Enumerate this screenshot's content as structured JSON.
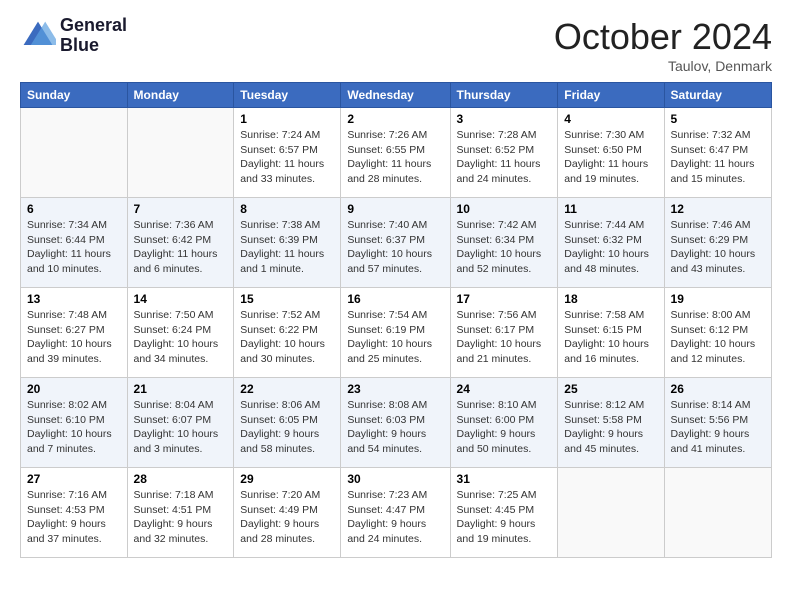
{
  "logo": {
    "line1": "General",
    "line2": "Blue"
  },
  "title": "October 2024",
  "location": "Taulov, Denmark",
  "days_header": [
    "Sunday",
    "Monday",
    "Tuesday",
    "Wednesday",
    "Thursday",
    "Friday",
    "Saturday"
  ],
  "weeks": [
    [
      {
        "day": "",
        "sunrise": "",
        "sunset": "",
        "daylight": ""
      },
      {
        "day": "",
        "sunrise": "",
        "sunset": "",
        "daylight": ""
      },
      {
        "day": "1",
        "sunrise": "Sunrise: 7:24 AM",
        "sunset": "Sunset: 6:57 PM",
        "daylight": "Daylight: 11 hours and 33 minutes."
      },
      {
        "day": "2",
        "sunrise": "Sunrise: 7:26 AM",
        "sunset": "Sunset: 6:55 PM",
        "daylight": "Daylight: 11 hours and 28 minutes."
      },
      {
        "day": "3",
        "sunrise": "Sunrise: 7:28 AM",
        "sunset": "Sunset: 6:52 PM",
        "daylight": "Daylight: 11 hours and 24 minutes."
      },
      {
        "day": "4",
        "sunrise": "Sunrise: 7:30 AM",
        "sunset": "Sunset: 6:50 PM",
        "daylight": "Daylight: 11 hours and 19 minutes."
      },
      {
        "day": "5",
        "sunrise": "Sunrise: 7:32 AM",
        "sunset": "Sunset: 6:47 PM",
        "daylight": "Daylight: 11 hours and 15 minutes."
      }
    ],
    [
      {
        "day": "6",
        "sunrise": "Sunrise: 7:34 AM",
        "sunset": "Sunset: 6:44 PM",
        "daylight": "Daylight: 11 hours and 10 minutes."
      },
      {
        "day": "7",
        "sunrise": "Sunrise: 7:36 AM",
        "sunset": "Sunset: 6:42 PM",
        "daylight": "Daylight: 11 hours and 6 minutes."
      },
      {
        "day": "8",
        "sunrise": "Sunrise: 7:38 AM",
        "sunset": "Sunset: 6:39 PM",
        "daylight": "Daylight: 11 hours and 1 minute."
      },
      {
        "day": "9",
        "sunrise": "Sunrise: 7:40 AM",
        "sunset": "Sunset: 6:37 PM",
        "daylight": "Daylight: 10 hours and 57 minutes."
      },
      {
        "day": "10",
        "sunrise": "Sunrise: 7:42 AM",
        "sunset": "Sunset: 6:34 PM",
        "daylight": "Daylight: 10 hours and 52 minutes."
      },
      {
        "day": "11",
        "sunrise": "Sunrise: 7:44 AM",
        "sunset": "Sunset: 6:32 PM",
        "daylight": "Daylight: 10 hours and 48 minutes."
      },
      {
        "day": "12",
        "sunrise": "Sunrise: 7:46 AM",
        "sunset": "Sunset: 6:29 PM",
        "daylight": "Daylight: 10 hours and 43 minutes."
      }
    ],
    [
      {
        "day": "13",
        "sunrise": "Sunrise: 7:48 AM",
        "sunset": "Sunset: 6:27 PM",
        "daylight": "Daylight: 10 hours and 39 minutes."
      },
      {
        "day": "14",
        "sunrise": "Sunrise: 7:50 AM",
        "sunset": "Sunset: 6:24 PM",
        "daylight": "Daylight: 10 hours and 34 minutes."
      },
      {
        "day": "15",
        "sunrise": "Sunrise: 7:52 AM",
        "sunset": "Sunset: 6:22 PM",
        "daylight": "Daylight: 10 hours and 30 minutes."
      },
      {
        "day": "16",
        "sunrise": "Sunrise: 7:54 AM",
        "sunset": "Sunset: 6:19 PM",
        "daylight": "Daylight: 10 hours and 25 minutes."
      },
      {
        "day": "17",
        "sunrise": "Sunrise: 7:56 AM",
        "sunset": "Sunset: 6:17 PM",
        "daylight": "Daylight: 10 hours and 21 minutes."
      },
      {
        "day": "18",
        "sunrise": "Sunrise: 7:58 AM",
        "sunset": "Sunset: 6:15 PM",
        "daylight": "Daylight: 10 hours and 16 minutes."
      },
      {
        "day": "19",
        "sunrise": "Sunrise: 8:00 AM",
        "sunset": "Sunset: 6:12 PM",
        "daylight": "Daylight: 10 hours and 12 minutes."
      }
    ],
    [
      {
        "day": "20",
        "sunrise": "Sunrise: 8:02 AM",
        "sunset": "Sunset: 6:10 PM",
        "daylight": "Daylight: 10 hours and 7 minutes."
      },
      {
        "day": "21",
        "sunrise": "Sunrise: 8:04 AM",
        "sunset": "Sunset: 6:07 PM",
        "daylight": "Daylight: 10 hours and 3 minutes."
      },
      {
        "day": "22",
        "sunrise": "Sunrise: 8:06 AM",
        "sunset": "Sunset: 6:05 PM",
        "daylight": "Daylight: 9 hours and 58 minutes."
      },
      {
        "day": "23",
        "sunrise": "Sunrise: 8:08 AM",
        "sunset": "Sunset: 6:03 PM",
        "daylight": "Daylight: 9 hours and 54 minutes."
      },
      {
        "day": "24",
        "sunrise": "Sunrise: 8:10 AM",
        "sunset": "Sunset: 6:00 PM",
        "daylight": "Daylight: 9 hours and 50 minutes."
      },
      {
        "day": "25",
        "sunrise": "Sunrise: 8:12 AM",
        "sunset": "Sunset: 5:58 PM",
        "daylight": "Daylight: 9 hours and 45 minutes."
      },
      {
        "day": "26",
        "sunrise": "Sunrise: 8:14 AM",
        "sunset": "Sunset: 5:56 PM",
        "daylight": "Daylight: 9 hours and 41 minutes."
      }
    ],
    [
      {
        "day": "27",
        "sunrise": "Sunrise: 7:16 AM",
        "sunset": "Sunset: 4:53 PM",
        "daylight": "Daylight: 9 hours and 37 minutes."
      },
      {
        "day": "28",
        "sunrise": "Sunrise: 7:18 AM",
        "sunset": "Sunset: 4:51 PM",
        "daylight": "Daylight: 9 hours and 32 minutes."
      },
      {
        "day": "29",
        "sunrise": "Sunrise: 7:20 AM",
        "sunset": "Sunset: 4:49 PM",
        "daylight": "Daylight: 9 hours and 28 minutes."
      },
      {
        "day": "30",
        "sunrise": "Sunrise: 7:23 AM",
        "sunset": "Sunset: 4:47 PM",
        "daylight": "Daylight: 9 hours and 24 minutes."
      },
      {
        "day": "31",
        "sunrise": "Sunrise: 7:25 AM",
        "sunset": "Sunset: 4:45 PM",
        "daylight": "Daylight: 9 hours and 19 minutes."
      },
      {
        "day": "",
        "sunrise": "",
        "sunset": "",
        "daylight": ""
      },
      {
        "day": "",
        "sunrise": "",
        "sunset": "",
        "daylight": ""
      }
    ]
  ]
}
